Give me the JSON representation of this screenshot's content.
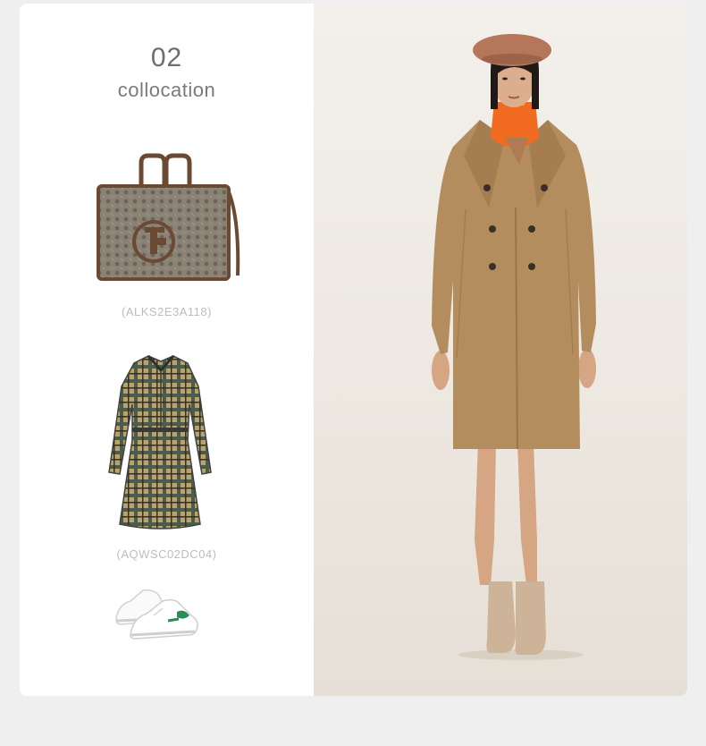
{
  "section": {
    "number": "02",
    "title": "collocation"
  },
  "products": [
    {
      "code": "(ALKS2E3A118)",
      "icon": "tote-bag-icon"
    },
    {
      "code": "(AQWSC02DC04)",
      "icon": "plaid-dress-icon"
    },
    {
      "code": "",
      "icon": "sneakers-icon"
    }
  ],
  "model_image": {
    "icon": "model-camel-coat-photo"
  },
  "colors": {
    "background": "#efefef",
    "card": "#ffffff",
    "text_dark": "#6e6e6e",
    "text_light": "#bdbdbd",
    "coat": "#b48d5e",
    "turtleneck": "#f06a1f",
    "beret": "#b5765a"
  }
}
